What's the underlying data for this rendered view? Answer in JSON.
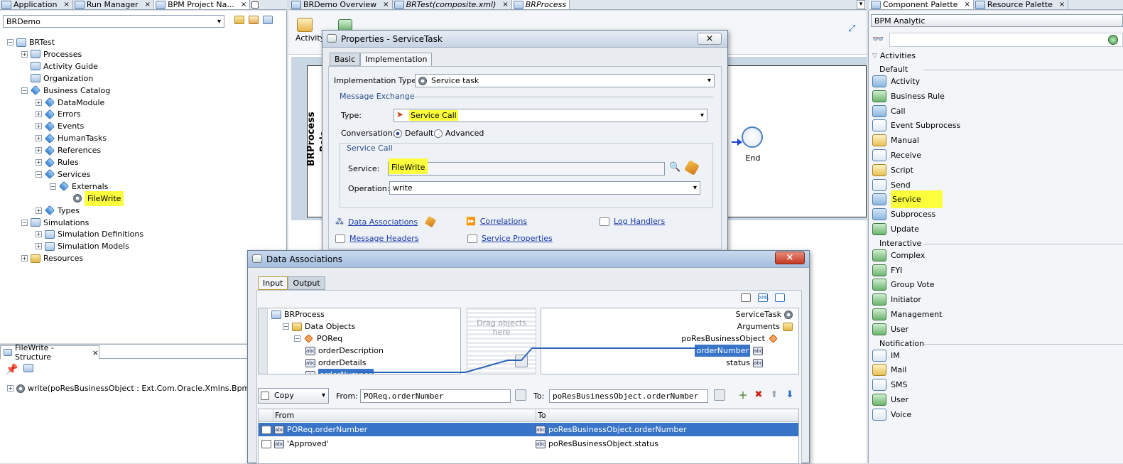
{
  "top_tabs_left": [
    {
      "label": "Application",
      "close": "×"
    },
    {
      "label": "Run Manager",
      "close": "×"
    },
    {
      "label": "BPM Project Na...",
      "close": "×"
    }
  ],
  "top_tabs_editor": [
    {
      "label": "BRDemo Overview",
      "close": "×"
    },
    {
      "label": "BRTest(composite.xml)",
      "close": "×"
    },
    {
      "label": "BRProcess",
      "close": "×"
    }
  ],
  "top_tabs_right": [
    {
      "label": "Component Palette",
      "close": "×"
    },
    {
      "label": "Resource Palette",
      "close": "×"
    }
  ],
  "project_selector": {
    "value": "BRDemo"
  },
  "project_tree": [
    {
      "label": "BRTest",
      "depth": 0,
      "expander": "−",
      "icon": "project-icon"
    },
    {
      "label": "Processes",
      "depth": 1,
      "expander": "+",
      "icon": "processes-icon"
    },
    {
      "label": "Activity Guide",
      "depth": 1,
      "expander": "",
      "icon": "activity-guide-icon"
    },
    {
      "label": "Organization",
      "depth": 1,
      "expander": "",
      "icon": "organization-icon"
    },
    {
      "label": "Business Catalog",
      "depth": 1,
      "expander": "−",
      "icon": "catalog-icon"
    },
    {
      "label": "DataModule",
      "depth": 2,
      "expander": "+",
      "icon": "catalog-icon"
    },
    {
      "label": "Errors",
      "depth": 2,
      "expander": "+",
      "icon": "catalog-icon"
    },
    {
      "label": "Events",
      "depth": 2,
      "expander": "+",
      "icon": "catalog-icon"
    },
    {
      "label": "HumanTasks",
      "depth": 2,
      "expander": "+",
      "icon": "catalog-icon"
    },
    {
      "label": "References",
      "depth": 2,
      "expander": "+",
      "icon": "catalog-icon"
    },
    {
      "label": "Rules",
      "depth": 2,
      "expander": "+",
      "icon": "catalog-icon"
    },
    {
      "label": "Services",
      "depth": 2,
      "expander": "−",
      "icon": "catalog-icon"
    },
    {
      "label": "Externals",
      "depth": 3,
      "expander": "−",
      "icon": "catalog-icon"
    },
    {
      "label": "FileWrite",
      "depth": 4,
      "expander": "",
      "icon": "service-icon",
      "highlight": true
    },
    {
      "label": "Types",
      "depth": 2,
      "expander": "+",
      "icon": "catalog-icon"
    },
    {
      "label": "Simulations",
      "depth": 1,
      "expander": "−",
      "icon": "simulation-icon"
    },
    {
      "label": "Simulation Definitions",
      "depth": 2,
      "expander": "+",
      "icon": "simulation-icon"
    },
    {
      "label": "Simulation Models",
      "depth": 2,
      "expander": "+",
      "icon": "simulation-icon"
    },
    {
      "label": "Resources",
      "depth": 1,
      "expander": "+",
      "icon": "folder-icon"
    }
  ],
  "structure_panel": {
    "title": "FileWrite - Structure",
    "close": "×",
    "row": "write(poResBusinessObject : Ext.Com.Oracle.Xmlns.Bpm.Bpmo"
  },
  "editor_toolbar": {
    "activity_label": "Activity"
  },
  "canvas": {
    "pool_label": "BRProcess",
    "lane_label": "Role",
    "end_label": "End"
  },
  "properties_dialog": {
    "title": "Properties - ServiceTask",
    "close": "×",
    "tabs": [
      "Basic",
      "Implementation"
    ],
    "implementation_type_label": "Implementation Type:",
    "implementation_type_value": "Service task",
    "message_exchange_legend": "Message Exchange",
    "type_label": "Type:",
    "type_value": "Service Call",
    "conversation_label": "Conversation:",
    "conversation_default": "Default",
    "conversation_advanced": "Advanced",
    "service_call_legend": "Service Call",
    "service_label": "Service:",
    "service_value": "FileWrite",
    "operation_label": "Operation:",
    "operation_value": "write",
    "links": [
      "Data Associations",
      "Correlations",
      "Log Handlers",
      "Message Headers",
      "Service Properties"
    ]
  },
  "data_assoc_dialog": {
    "title": "Data Associations",
    "close": "×",
    "tabs": [
      "Input",
      "Output"
    ],
    "left_tree": [
      {
        "label": "BRProcess",
        "depth": 0,
        "expander": ""
      },
      {
        "label": "Data Objects",
        "depth": 1,
        "expander": "−"
      },
      {
        "label": "POReq",
        "depth": 2,
        "expander": "−"
      },
      {
        "label": "orderDescription",
        "depth": 3,
        "expander": ""
      },
      {
        "label": "orderDetails",
        "depth": 3,
        "expander": ""
      },
      {
        "label": "orderNumber",
        "depth": 3,
        "expander": ""
      }
    ],
    "drag_hint": "Drag objects here",
    "right_tree": [
      {
        "label": "ServiceTask"
      },
      {
        "label": "Arguments"
      },
      {
        "label": "poResBusinessObject"
      },
      {
        "label": "orderNumber"
      },
      {
        "label": "status"
      }
    ],
    "operation": "Copy",
    "from_label": "From:",
    "from_value": "POReq.orderNumber",
    "to_label": "To:",
    "to_value": "poResBusinessObject.orderNumber",
    "grid_headers": [
      "From",
      "To"
    ],
    "grid_rows": [
      {
        "from": "POReq.orderNumber",
        "to": "poResBusinessObject.orderNumber"
      },
      {
        "from": "'Approved'",
        "to": "poResBusinessObject.status"
      }
    ]
  },
  "palette": {
    "dropdown": "BPM Analytic",
    "activities_header": "Activities",
    "sections": [
      {
        "title": "Default",
        "items": [
          "Activity",
          "Business Rule",
          "Call",
          "Event Subprocess",
          "Manual",
          "Receive",
          "Script",
          "Send",
          "Service",
          "Subprocess",
          "Update"
        ]
      },
      {
        "title": "Interactive",
        "items": [
          "Complex",
          "FYI",
          "Group Vote",
          "Initiator",
          "Management",
          "User"
        ]
      },
      {
        "title": "Notification",
        "items": [
          "IM",
          "Mail",
          "SMS",
          "User",
          "Voice"
        ]
      }
    ]
  },
  "colors": {
    "highlight": "#fbff3c",
    "selection": "#3874c8",
    "link": "#1a3aa8"
  }
}
